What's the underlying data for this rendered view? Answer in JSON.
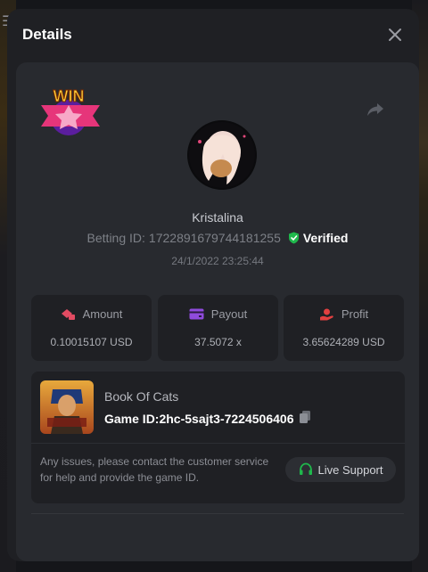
{
  "modal": {
    "title": "Details"
  },
  "badge": {
    "text": "WIN"
  },
  "user": {
    "name": "Kristalina",
    "betting_label": "Betting ID:",
    "betting_id": "1722891679744181255",
    "verified_label": "Verified",
    "timestamp": "24/1/2022 23:25:44"
  },
  "stats": [
    {
      "label": "Amount",
      "value": "0.10015107 USD",
      "icon": "amount-icon",
      "color": "#e24b62"
    },
    {
      "label": "Payout",
      "value": "37.5072 x",
      "icon": "payout-card-icon",
      "color": "#8f4bdc"
    },
    {
      "label": "Profit",
      "value": "3.65624289 USD",
      "icon": "profit-hand-icon",
      "color": "#e24040"
    }
  ],
  "game": {
    "name": "Book Of Cats",
    "id_label": "Game ID:",
    "id": "2hc-5sajt3-7224506406",
    "notice": "Any issues, please contact the customer service for help and provide the game ID.",
    "support_label": "Live Support"
  },
  "colors": {
    "accent_green": "#1fb84c",
    "modal_bg": "#1f2024",
    "card_bg": "#282a2f"
  }
}
